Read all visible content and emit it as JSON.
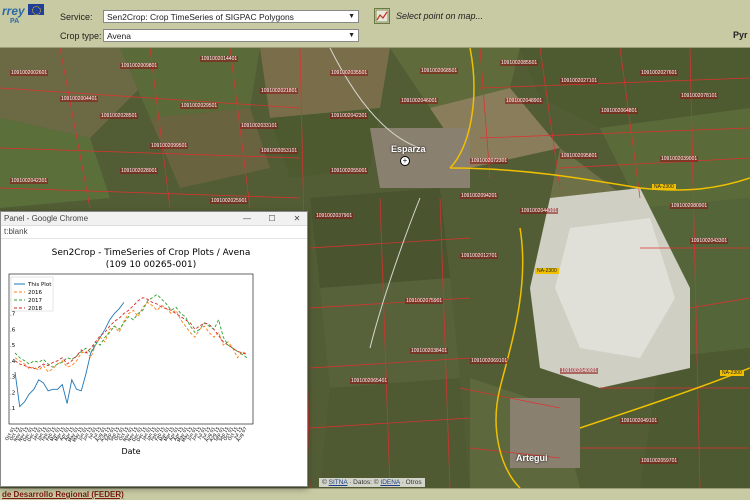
{
  "header": {
    "logo_text": "rrey",
    "logo_subtext": "PA",
    "service_label": "Service:",
    "service_value": "Sen2Crop: Crop TimeSeries of SIGPAC Polygons",
    "crop_label": "Crop type:",
    "crop_value": "Avena",
    "select_hint": "Select point on map...",
    "user_label": "Pyr"
  },
  "map": {
    "towns": [
      {
        "name": "Esparza"
      },
      {
        "name": "Artegui"
      }
    ],
    "road_tags": [
      "NA-2300",
      "NA-2300",
      "NA-2300"
    ],
    "plot_labels": [
      "1091002002601",
      "1091002004401",
      "1091002009801",
      "1091002014401",
      "1091002021801",
      "1091002035501",
      "1091002068501",
      "1091002085501",
      "1091002027101",
      "1091002027601",
      "1091002028501",
      "1091002029501",
      "1091002033101",
      "1091002042301",
      "1091002046001",
      "1091002048901",
      "1091002064801",
      "1091002078101",
      "1091002099501",
      "1091002053101",
      "1091002055001",
      "1091002072301",
      "1091002095801",
      "1091002039001",
      "1091002042301",
      "1091002028001",
      "1091002025901",
      "1091002037901",
      "1091002094201",
      "1091002044101",
      "1091002080901",
      "1091002043301",
      "1091002012701",
      "1091002075901",
      "1091002038401",
      "1091002065401",
      "1091002069101",
      "1091002040001",
      "1091002049101",
      "1091002059701"
    ],
    "attribution": {
      "prefix": "©",
      "sitna": "SITNA",
      "mid": " · Datos: ©",
      "idena": "IDENA",
      "suffix": " · Otros"
    }
  },
  "footer": {
    "text": "de Desarrollo Regional (FEDER)"
  },
  "popup": {
    "window_title": "Panel - Google Chrome",
    "address": "t:blank",
    "min_glyph": "—",
    "max_glyph": "☐",
    "close_glyph": "✕"
  },
  "chart_data": {
    "type": "line",
    "title": "Sen2Crop - TimeSeries of Crop Plots / Avena",
    "subtitle": "(109 10 00265-001)",
    "xlabel": "Date",
    "ylabel": "",
    "ylim": [
      0.0,
      0.95
    ],
    "yticks": [
      0.1,
      0.2,
      0.3,
      0.4,
      0.5,
      0.6,
      0.7,
      0.8
    ],
    "ytick_labels": [
      ".1",
      ".2",
      ".3",
      ".4",
      ".5",
      ".6",
      ".7",
      ".8"
    ],
    "x_tick_labels": [
      "Oct 01",
      "Oct 15",
      "Nov 01",
      "Nov 15",
      "Dec 01",
      "Dec 15",
      "Jan 01",
      "Jan 15",
      "Feb 01",
      "Feb 15",
      "Mar 01",
      "Mar 15",
      "Apr 01",
      "Apr 15",
      "May 01",
      "May 15",
      "Jun 01",
      "Jun 15",
      "Jul 01",
      "Jul 15",
      "Aug 01",
      "Aug 15",
      "Sep 01",
      "Sep 15",
      "Oct 01",
      "Oct 15",
      "Nov 01",
      "Nov 15",
      "Dec 01",
      "Dec 15",
      "Jan 01",
      "Jan 15",
      "Feb 01",
      "Feb 15",
      "Mar 01",
      "Mar 15",
      "Apr 01",
      "Apr 15",
      "May 01",
      "May 15",
      "Jun 01",
      "Jun 15",
      "Jul 01",
      "Jul 15",
      "Aug 01",
      "Aug 15",
      "Sep 01",
      "Sep 15",
      "Oct 01",
      "Oct 15",
      "Jul 15",
      "Aug 07"
    ],
    "legend_position": "top-left",
    "grid": false,
    "series": [
      {
        "name": "This Plot",
        "color": "#1f77b4",
        "dash": "",
        "x": [
          0,
          1,
          2,
          3,
          4,
          5,
          6,
          7,
          8,
          9,
          10,
          11,
          12,
          13,
          14,
          15,
          16,
          17,
          18,
          19,
          20,
          21,
          22,
          23
        ],
        "values": [
          0.33,
          0.11,
          0.14,
          0.19,
          0.22,
          0.28,
          0.26,
          0.21,
          0.22,
          0.22,
          0.25,
          0.13,
          0.28,
          0.22,
          0.21,
          0.32,
          0.45,
          0.5,
          0.55,
          0.6,
          0.66,
          0.7,
          0.73,
          0.77
        ]
      },
      {
        "name": "2016",
        "color": "#ff7f0e",
        "dash": "3,2",
        "x": [
          0,
          1,
          2,
          3,
          4,
          5,
          6,
          7,
          8,
          9,
          10,
          11,
          12,
          13,
          14,
          15,
          16,
          17,
          18,
          19,
          20,
          21,
          22,
          23,
          24,
          25,
          26,
          27,
          28,
          29,
          30,
          31,
          32,
          33,
          34,
          35,
          36,
          37,
          38,
          39,
          40,
          41,
          42,
          43,
          44,
          45,
          46,
          47,
          48,
          49
        ],
        "values": [
          0.42,
          0.4,
          0.38,
          0.35,
          0.36,
          0.34,
          0.37,
          0.33,
          0.35,
          0.38,
          0.4,
          0.36,
          0.37,
          0.4,
          0.45,
          0.46,
          0.42,
          0.5,
          0.55,
          0.52,
          0.6,
          0.62,
          0.58,
          0.65,
          0.7,
          0.72,
          0.68,
          0.74,
          0.77,
          0.75,
          0.72,
          0.75,
          0.73,
          0.7,
          0.72,
          0.66,
          0.62,
          0.58,
          0.55,
          0.6,
          0.62,
          0.58,
          0.55,
          0.58,
          0.5,
          0.52,
          0.48,
          0.42,
          0.46,
          0.44
        ]
      },
      {
        "name": "2017",
        "color": "#2ca02c",
        "dash": "3,2",
        "x": [
          0,
          1,
          2,
          3,
          4,
          5,
          6,
          7,
          8,
          9,
          10,
          11,
          12,
          13,
          14,
          15,
          16,
          17,
          18,
          19,
          20,
          21,
          22,
          23,
          24,
          25,
          26,
          27,
          28,
          29,
          30,
          31,
          32,
          33,
          34,
          35,
          36,
          37,
          38,
          39,
          40,
          41,
          42,
          43,
          44,
          45,
          46,
          47,
          48,
          49
        ],
        "values": [
          0.45,
          0.42,
          0.4,
          0.38,
          0.4,
          0.39,
          0.41,
          0.38,
          0.36,
          0.38,
          0.39,
          0.42,
          0.41,
          0.43,
          0.46,
          0.48,
          0.45,
          0.52,
          0.5,
          0.55,
          0.58,
          0.62,
          0.6,
          0.64,
          0.68,
          0.66,
          0.7,
          0.72,
          0.78,
          0.8,
          0.82,
          0.79,
          0.76,
          0.72,
          0.74,
          0.7,
          0.68,
          0.62,
          0.58,
          0.6,
          0.64,
          0.62,
          0.6,
          0.66,
          0.55,
          0.5,
          0.48,
          0.46,
          0.44,
          0.42
        ]
      },
      {
        "name": "2018",
        "color": "#d62728",
        "dash": "3,2",
        "x": [
          0,
          1,
          2,
          3,
          4,
          5,
          6,
          7,
          8,
          9,
          10,
          11,
          12,
          13,
          14,
          15,
          16,
          17,
          18,
          19,
          20,
          21,
          22,
          23,
          24,
          25,
          26,
          27,
          28,
          29,
          30,
          31,
          32,
          33,
          34,
          35,
          36,
          37,
          38,
          39,
          40,
          41,
          42,
          43,
          44,
          45,
          46,
          47,
          48,
          49
        ],
        "values": [
          0.4,
          0.38,
          0.37,
          0.36,
          0.35,
          0.36,
          0.38,
          0.37,
          0.39,
          0.4,
          0.42,
          0.38,
          0.4,
          0.43,
          0.47,
          0.45,
          0.48,
          0.52,
          0.56,
          0.58,
          0.62,
          0.65,
          0.67,
          0.7,
          0.72,
          0.75,
          0.78,
          0.8,
          0.79,
          0.77,
          0.76,
          0.74,
          0.73,
          0.72,
          0.7,
          0.68,
          0.66,
          0.64,
          0.6,
          0.62,
          0.64,
          0.63,
          0.6,
          0.56,
          0.52,
          0.5,
          0.48,
          0.46,
          0.45,
          0.44
        ]
      }
    ]
  }
}
